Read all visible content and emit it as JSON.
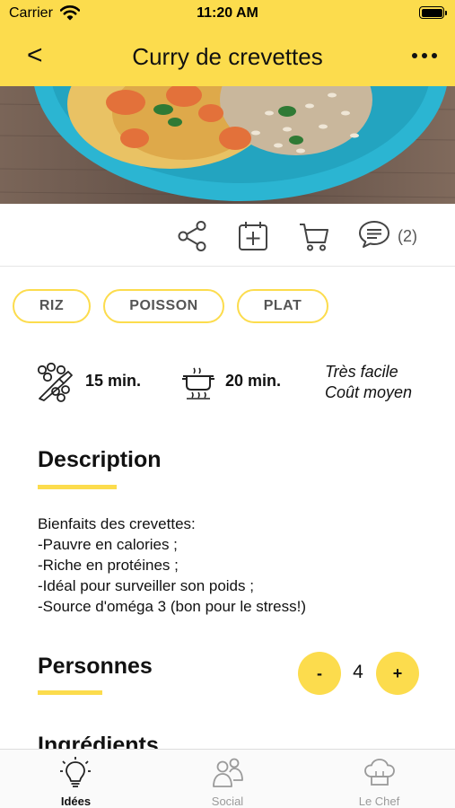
{
  "status_bar": {
    "carrier": "Carrier",
    "time": "11:20 AM"
  },
  "nav": {
    "back_label": "<",
    "title": "Curry de crevettes"
  },
  "actions": {
    "comment_count": "(2)"
  },
  "tags": [
    "RIZ",
    "POISSON",
    "PLAT"
  ],
  "info": {
    "prep_time": "15 min.",
    "cook_time": "20 min.",
    "difficulty": "Très facile",
    "cost": "Coût moyen"
  },
  "description": {
    "title": "Description",
    "lines": [
      "Bienfaits des crevettes:",
      "-Pauvre en calories ;",
      "-Riche en protéines ;",
      "-Idéal pour surveiller son poids ;",
      "-Source d'oméga 3 (bon pour le stress!)"
    ]
  },
  "persons": {
    "title": "Personnes",
    "minus_label": "-",
    "plus_label": "+",
    "value": "4"
  },
  "ingredients": {
    "title": "Ingrédients"
  },
  "tab_bar": {
    "tabs": [
      {
        "label": "Idées",
        "icon": "lightbulb-icon",
        "active": true
      },
      {
        "label": "Social",
        "icon": "people-icon",
        "active": false
      },
      {
        "label": "Le Chef",
        "icon": "chef-hat-icon",
        "active": false
      }
    ]
  },
  "colors": {
    "accent": "#FCDC4D",
    "text": "#111111",
    "muted": "#9A9A9A",
    "plate": "#2BB5D2"
  }
}
